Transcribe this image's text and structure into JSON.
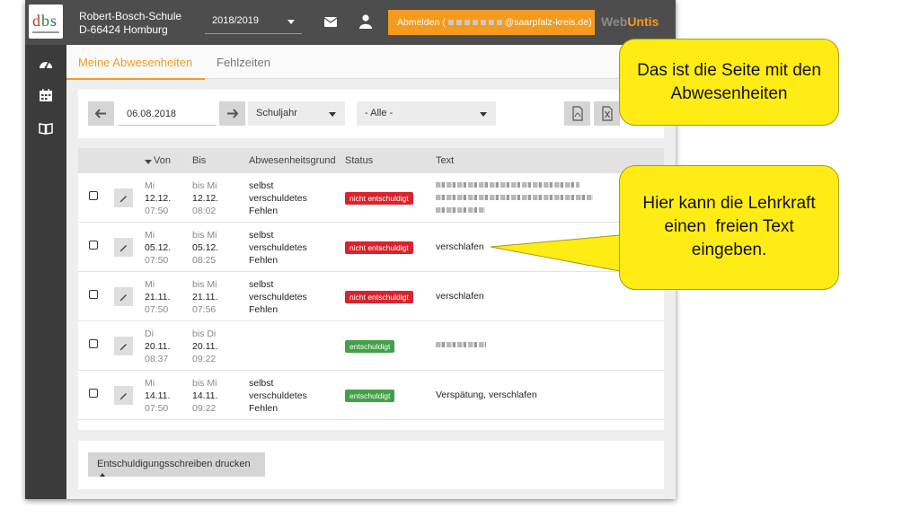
{
  "header": {
    "school_name": "Robert-Bosch-Schule",
    "school_city": "D-66424 Homburg",
    "school_year": "2018/2019",
    "logout_prefix": "Abmelden (",
    "logout_suffix": "@saarpfalz-kreis.de)",
    "brand_part1": "Web",
    "brand_part2": "Untis"
  },
  "sidebar": {
    "icons": [
      "dashboard-icon",
      "calendar-icon",
      "book-icon"
    ]
  },
  "tabs": [
    {
      "label": "Meine Abwesenheiten",
      "active": true
    },
    {
      "label": "Fehlzeiten",
      "active": false
    }
  ],
  "filters": {
    "date": "06.08.2018",
    "period": "Schuljahr",
    "filter": "- Alle -"
  },
  "table": {
    "headers": [
      "Von",
      "Bis",
      "Abwesenheitsgrund",
      "Status",
      "Text"
    ],
    "rows": [
      {
        "from_day": "Mi",
        "from_date": "12.12.",
        "from_time": "07:50",
        "to_day": "bis Mi",
        "to_date": "12.12.",
        "to_time": "08:02",
        "reason": [
          "selbst",
          "verschuldetes",
          "Fehlen"
        ],
        "status": "nicht entschuldigt",
        "text": ""
      },
      {
        "from_day": "Mi",
        "from_date": "05.12.",
        "from_time": "07:50",
        "to_day": "bis Mi",
        "to_date": "05.12.",
        "to_time": "08:25",
        "reason": [
          "selbst",
          "verschuldetes",
          "Fehlen"
        ],
        "status": "nicht entschuldigt",
        "text": "verschlafen"
      },
      {
        "from_day": "Mi",
        "from_date": "21.11.",
        "from_time": "07:50",
        "to_day": "bis Mi",
        "to_date": "21.11.",
        "to_time": "07:56",
        "reason": [
          "selbst",
          "verschuldetes",
          "Fehlen"
        ],
        "status": "nicht entschuldigt",
        "text": "verschlafen"
      },
      {
        "from_day": "Di",
        "from_date": "20.11.",
        "from_time": "08:37",
        "to_day": "bis Di",
        "to_date": "20.11.",
        "to_time": "09:22",
        "reason": [
          "",
          "",
          ""
        ],
        "status": "entschuldigt",
        "text": ""
      },
      {
        "from_day": "Mi",
        "from_date": "14.11.",
        "from_time": "07:50",
        "to_day": "bis Mi",
        "to_date": "14.11.",
        "to_time": "09:22",
        "reason": [
          "selbst",
          "verschuldetes",
          "Fehlen"
        ],
        "status": "entschuldigt",
        "text": "Verspätung, verschlafen"
      }
    ]
  },
  "footer": {
    "print_label": "Entschuldigungsschreiben drucken"
  },
  "callouts": {
    "c1_line1": "Das ist die Seite mit den",
    "c1_line2": "Abwesenheiten",
    "c2_line1": "Hier kann die Lehrkraft",
    "c2_line2": "einen  freien Text",
    "c2_line3": "eingeben."
  },
  "colors": {
    "accent": "#f49a1e",
    "topbar": "#4d4d4d",
    "sidebar": "#3b3b3b",
    "badge_red": "#d9232d",
    "badge_green": "#43a047",
    "callout": "#ffec14"
  }
}
